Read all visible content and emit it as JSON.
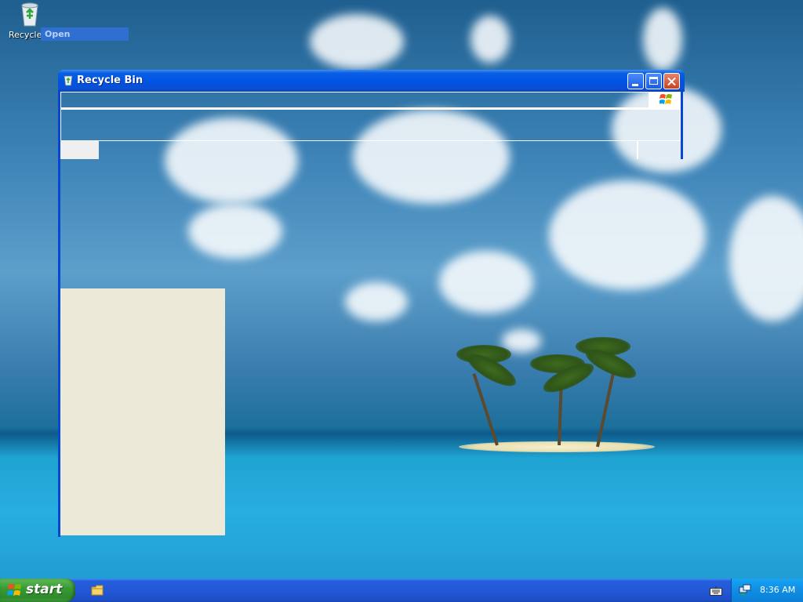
{
  "desktop": {
    "recycle_bin_label": "Recycle Bin",
    "context_menu_open": "Open"
  },
  "window": {
    "title": "Recycle Bin"
  },
  "taskbar": {
    "start_label": "start",
    "clock": "8:36 AM"
  },
  "colors": {
    "titlebar": "#0054e3",
    "start_button": "#3a9b35",
    "taskbar": "#245edb",
    "task_pane": "#ece9d8"
  },
  "icons": {
    "recycle_bin": "recycle-bin-icon",
    "windows_logo": "windows-logo-icon",
    "folder": "folder-icon",
    "keyboard": "keyboard-icon",
    "network": "network-icon"
  }
}
